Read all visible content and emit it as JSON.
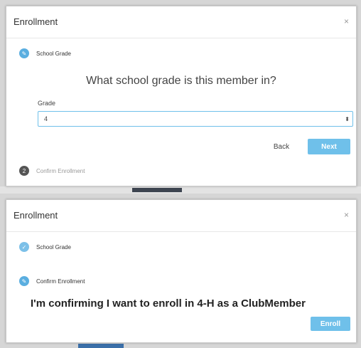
{
  "modal1": {
    "title": "Enrollment",
    "close_glyph": "×",
    "steps": [
      {
        "label": "School Grade",
        "state": "active",
        "icon": "pencil-icon",
        "glyph": "✎"
      },
      {
        "label": "Confirm Enrollment",
        "state": "pending",
        "icon": "step-number-icon",
        "glyph": "2"
      }
    ],
    "question": "What school grade is this member in?",
    "grade_label": "Grade",
    "grade_value": "4",
    "caret_glyph": "▴▾",
    "back_label": "Back",
    "next_label": "Next"
  },
  "modal2": {
    "title": "Enrollment",
    "close_glyph": "×",
    "steps": [
      {
        "label": "School Grade",
        "state": "done",
        "icon": "check-icon",
        "glyph": "✓"
      },
      {
        "label": "Confirm Enrollment",
        "state": "active",
        "icon": "pencil-icon",
        "glyph": "✎"
      }
    ],
    "confirm_text": "I'm confirming I want to enroll in 4-H as a ClubMember",
    "enroll_label": "Enroll"
  },
  "colors": {
    "accent": "#6fc0ea",
    "step_pending": "#555555"
  }
}
